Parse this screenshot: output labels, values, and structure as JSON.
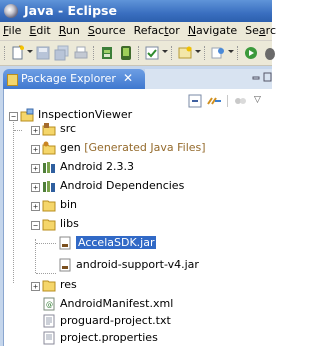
{
  "window": {
    "title": "Java - Eclipse"
  },
  "menu": [
    {
      "pre": "",
      "u": "F",
      "post": "ile"
    },
    {
      "pre": "",
      "u": "E",
      "post": "dit"
    },
    {
      "pre": "",
      "u": "R",
      "post": "un"
    },
    {
      "pre": "",
      "u": "S",
      "post": "ource"
    },
    {
      "pre": "Refac",
      "u": "t",
      "post": "or"
    },
    {
      "pre": "",
      "u": "N",
      "post": "avigate"
    },
    {
      "pre": "Se",
      "u": "a",
      "post": "rc"
    }
  ],
  "view": {
    "tab_label": "Package Explorer",
    "close_glyph": "✕"
  },
  "tree": [
    {
      "label": "InspectionViewer",
      "icon": "project-icon"
    },
    {
      "label": "src",
      "icon": "source-folder-icon"
    },
    {
      "label": "gen",
      "decoration": "[Generated Java Files]",
      "icon": "generated-folder-icon"
    },
    {
      "label": "Android 2.3.3",
      "icon": "library-icon"
    },
    {
      "label": "Android Dependencies",
      "icon": "library-icon"
    },
    {
      "label": "bin",
      "icon": "folder-icon"
    },
    {
      "label": "libs",
      "icon": "folder-icon"
    },
    {
      "label": "AccelaSDK.jar",
      "icon": "jar-icon",
      "selected": true
    },
    {
      "label": "android-support-v4.jar",
      "icon": "jar-icon"
    },
    {
      "label": "res",
      "icon": "folder-icon"
    },
    {
      "label": "AndroidManifest.xml",
      "icon": "xml-file-icon"
    },
    {
      "label": "proguard-project.txt",
      "icon": "text-file-icon"
    },
    {
      "label": "project.properties",
      "icon": "properties-file-icon"
    }
  ],
  "colors": {
    "titlebar": "#3a6fc0",
    "selection": "#3169c6",
    "chrome": "#ece9d8",
    "decoration": "#946a2c"
  }
}
